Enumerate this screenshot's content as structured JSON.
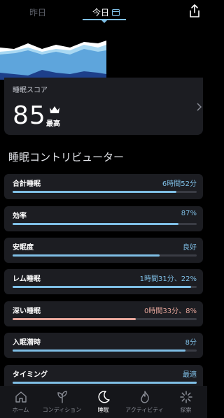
{
  "top_tabs": {
    "yesterday": "昨日",
    "today": "今日"
  },
  "score": {
    "label": "睡眠スコア",
    "value": "85",
    "grade": "最高"
  },
  "section_title": "睡眠コントリビューター",
  "contributors": [
    {
      "label": "合計睡眠",
      "value": "6時間52分",
      "progress": 0.89,
      "status": "normal"
    },
    {
      "label": "効率",
      "value": "87%",
      "progress": 0.9,
      "status": "normal"
    },
    {
      "label": "安眠度",
      "value": "良好",
      "progress": 0.8,
      "status": "normal"
    },
    {
      "label": "レム睡眠",
      "value": "1時間31分、22%",
      "progress": 0.97,
      "status": "normal"
    },
    {
      "label": "深い睡眠",
      "value": "0時間33分、8%",
      "progress": 0.67,
      "status": "warning"
    },
    {
      "label": "入眠潜時",
      "value": "8分",
      "progress": 0.94,
      "status": "normal"
    },
    {
      "label": "タイミング",
      "value": "最適",
      "progress": 1.0,
      "status": "normal"
    }
  ],
  "nav": [
    {
      "label": "ホーム",
      "icon": "home-icon",
      "active": false
    },
    {
      "label": "コンディション",
      "icon": "sprout-icon",
      "active": false
    },
    {
      "label": "睡眠",
      "icon": "moon-icon",
      "active": true
    },
    {
      "label": "アクティビティ",
      "icon": "flame-icon",
      "active": false
    },
    {
      "label": "探索",
      "icon": "explore-icon",
      "active": false
    }
  ],
  "colors": {
    "accent": "#7fbfe6",
    "warning": "#e8a79c",
    "card": "#1c1d22"
  }
}
